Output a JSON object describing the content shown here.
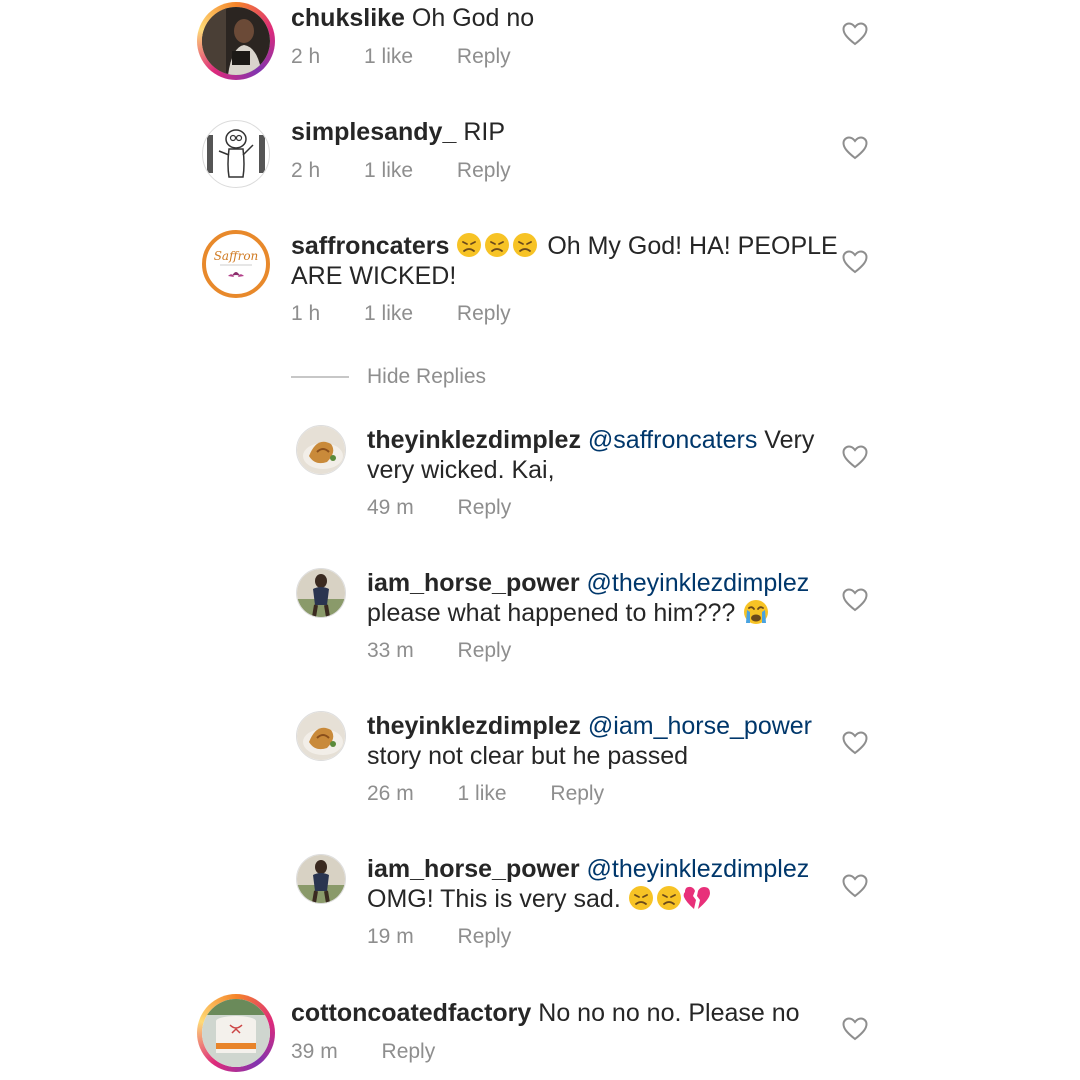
{
  "comments": [
    {
      "username": "chukslike",
      "text": "Oh God no",
      "time": "2 h",
      "likes": "1 like",
      "reply": "Reply"
    },
    {
      "username": "simplesandy_",
      "text": "RIP",
      "time": "2 h",
      "likes": "1 like",
      "reply": "Reply"
    },
    {
      "username": "saffroncaters",
      "emoji": "sad-face-emoji x3",
      "text_line1": "Oh My God! HA! PEOPLE",
      "text_line2": "ARE WICKED!",
      "time": "1 h",
      "likes": "1 like",
      "reply": "Reply",
      "hide_replies": "Hide Replies",
      "avatar_text": "Saffron"
    },
    {
      "username": "cottoncoatedfactory",
      "text": "No no no no. Please no",
      "time": "39 m",
      "reply": "Reply"
    }
  ],
  "replies": [
    {
      "username": "theyinklezdimplez",
      "mention": "@saffroncaters",
      "text_line1_suffix": "Very",
      "text_line2": "very wicked. Kai,",
      "time": "49 m",
      "reply": "Reply"
    },
    {
      "username": "iam_horse_power",
      "mention": "@theyinklezdimplez",
      "text_line2": "please what happened to him???",
      "emoji": "crying-face-emoji",
      "time": "33 m",
      "reply": "Reply"
    },
    {
      "username": "theyinklezdimplez",
      "mention": "@iam_horse_power",
      "text_line2": "story not clear but he passed",
      "time": "26 m",
      "likes": "1 like",
      "reply": "Reply"
    },
    {
      "username": "iam_horse_power",
      "mention": "@theyinklezdimplez",
      "text_line2": "OMG! This is very sad.",
      "emoji": "sad-faces-and-broken-heart-emoji",
      "time": "19 m",
      "reply": "Reply"
    }
  ],
  "colors": {
    "text": "#262626",
    "meta": "#8e8e8e",
    "mention": "#00376b",
    "heart_stroke": "#8e8e8e",
    "story_ring": "#dd2a7b",
    "saffron_ring": "#e8892b"
  }
}
